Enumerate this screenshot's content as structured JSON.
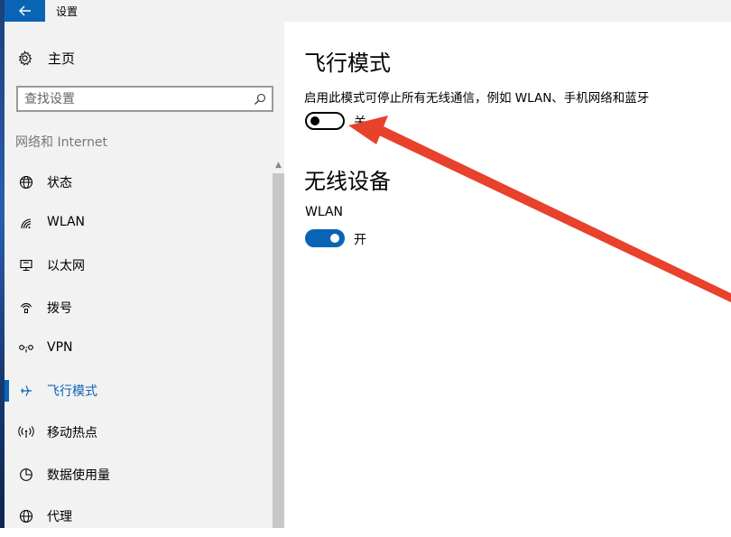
{
  "window": {
    "title": "设置",
    "back_icon": "back-arrow-icon",
    "accent": "#0a64b5"
  },
  "sidebar": {
    "home_label": "主页",
    "home_icon": "gear-icon",
    "search_placeholder": "查找设置",
    "section_title": "网络和 Internet",
    "items": [
      {
        "label": "状态",
        "icon": "globe-icon"
      },
      {
        "label": "WLAN",
        "icon": "wifi-icon"
      },
      {
        "label": "以太网",
        "icon": "ethernet-icon"
      },
      {
        "label": "拨号",
        "icon": "dialup-icon"
      },
      {
        "label": "VPN",
        "icon": "vpn-icon"
      },
      {
        "label": "飞行模式",
        "icon": "airplane-icon",
        "selected": true
      },
      {
        "label": "移动热点",
        "icon": "hotspot-icon"
      },
      {
        "label": "数据使用量",
        "icon": "data-usage-icon"
      },
      {
        "label": "代理",
        "icon": "globe-icon"
      }
    ]
  },
  "main": {
    "airplane": {
      "title": "飞行模式",
      "description": "启用此模式可停止所有无线通信，例如 WLAN、手机网络和蓝牙",
      "toggle_on": false,
      "toggle_label": "关"
    },
    "wireless": {
      "title": "无线设备",
      "wlan_label": "WLAN",
      "toggle_on": true,
      "toggle_label": "开"
    }
  },
  "annotation": {
    "arrow_color": "#e8412c"
  }
}
